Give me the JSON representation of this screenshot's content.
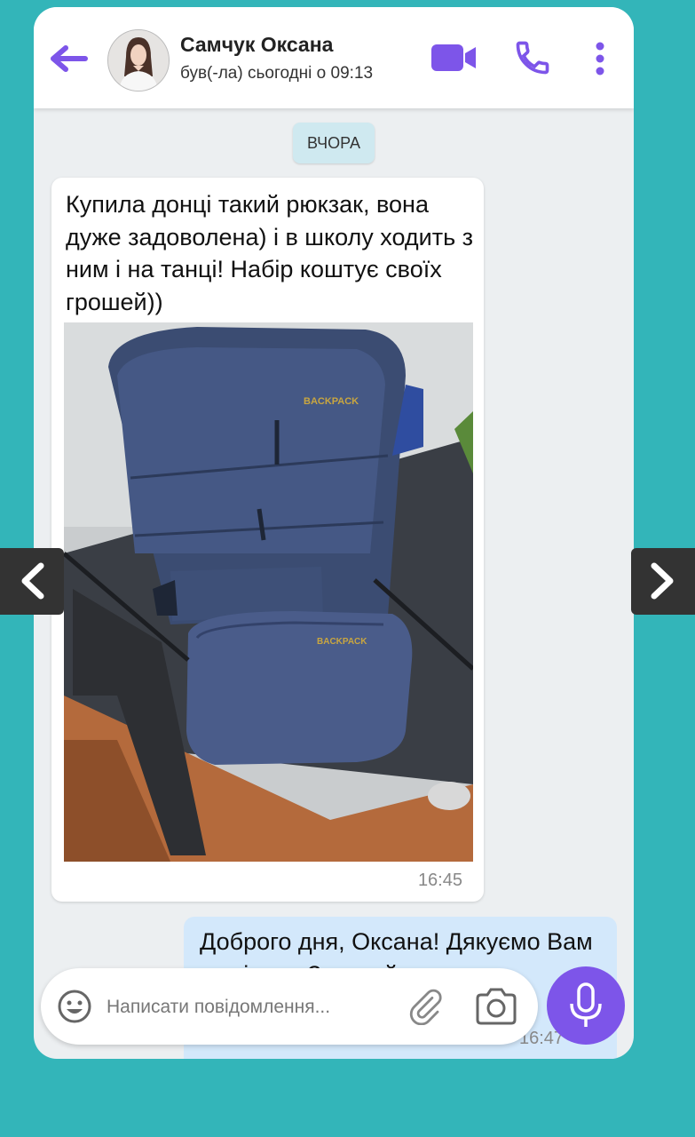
{
  "header": {
    "contact_name": "Самчук Оксана",
    "status": "був(-ла) сьогодні о 09:13",
    "back_icon": "arrow-left-icon",
    "video_icon": "video-camera-icon",
    "call_icon": "phone-icon",
    "menu_icon": "more-vertical-icon",
    "accent_color": "#7d55e9"
  },
  "date_separator": "ВЧОРА",
  "messages": [
    {
      "direction": "incoming",
      "text": "Купила донці такий рюкзак, вона дуже задоволена) і в школу ходить з ним і на танці! Набір коштує своїх грошей))",
      "photo_label_1": "BACKPACK",
      "photo_label_2": "BACKPACK",
      "time": "16:45"
    },
    {
      "direction": "outgoing",
      "text": "Доброго дня, Оксана! Дякуємо Вам за відгук. Звертайтеся ще",
      "time": "16:47"
    }
  ],
  "composer": {
    "placeholder": "Написати повідомлення...",
    "emoji_icon": "smiley-icon",
    "attach_icon": "paperclip-icon",
    "camera_icon": "camera-icon",
    "mic_icon": "microphone-icon"
  },
  "navigation": {
    "prev_icon": "chevron-left-icon",
    "next_icon": "chevron-right-icon"
  }
}
